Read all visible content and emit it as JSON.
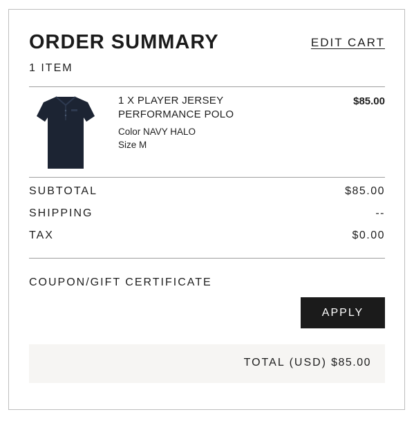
{
  "header": {
    "title": "ORDER SUMMARY",
    "edit_cart": "EDIT CART",
    "item_count": "1 ITEM"
  },
  "product": {
    "quantity_line": "1 X PLAYER JERSEY",
    "name_line": "PERFORMANCE POLO",
    "color": "Color NAVY HALO",
    "size": "Size M",
    "price": "$85.00",
    "image_color": "#1c2433"
  },
  "summary": {
    "subtotal_label": "SUBTOTAL",
    "subtotal_value": "$85.00",
    "shipping_label": "SHIPPING",
    "shipping_value": "--",
    "tax_label": "TAX",
    "tax_value": "$0.00"
  },
  "coupon": {
    "label": "COUPON/GIFT CERTIFICATE",
    "apply_label": "APPLY"
  },
  "total": {
    "label": "TOTAL (USD)",
    "value": "$85.00"
  }
}
